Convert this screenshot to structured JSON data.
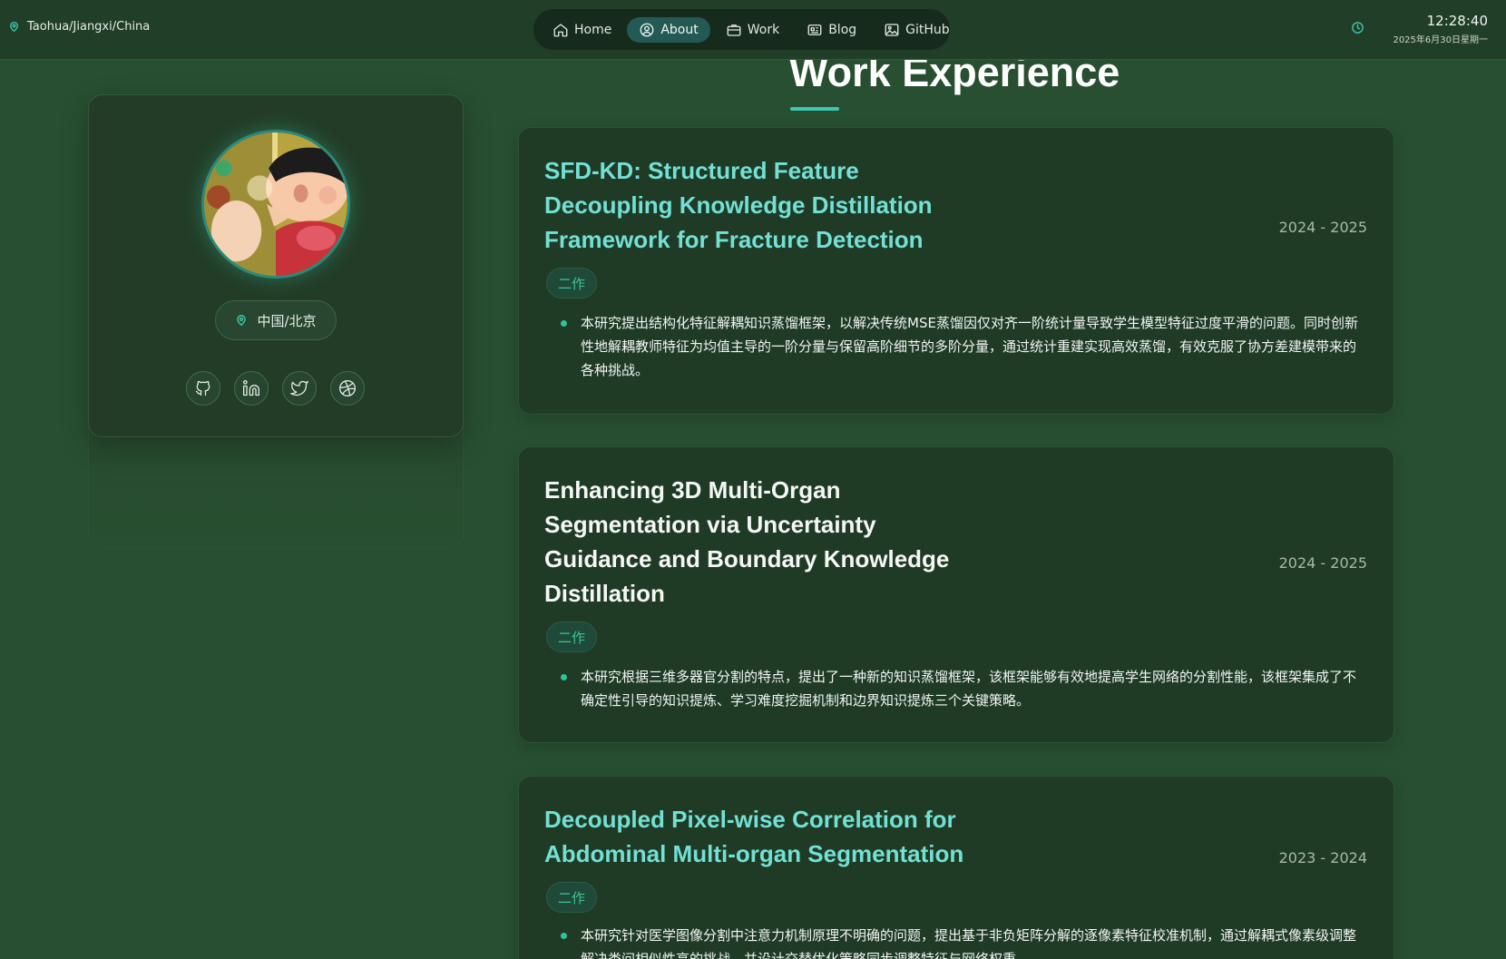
{
  "topbar": {
    "location": "Taohua/Jiangxi/China",
    "time": "12:28:40",
    "date": "2025年6月30日星期一"
  },
  "nav": [
    {
      "label": "Home",
      "icon": "home-icon",
      "active": false
    },
    {
      "label": "About",
      "icon": "user-circle-icon",
      "active": true
    },
    {
      "label": "Work",
      "icon": "briefcase-icon",
      "active": false
    },
    {
      "label": "Blog",
      "icon": "newspaper-icon",
      "active": false
    },
    {
      "label": "GitHub",
      "icon": "image-icon",
      "active": false
    }
  ],
  "profile": {
    "location": "中国/北京",
    "socials": [
      "github-icon",
      "linkedin-icon",
      "twitter-icon",
      "dribbble-icon"
    ]
  },
  "section": {
    "title": "Work Experience"
  },
  "works": [
    {
      "title": "SFD-KD: Structured Feature Decoupling Knowledge Distillation Framework for Fracture Detection",
      "date": "2024 - 2025",
      "badge": "二作",
      "description": "本研究提出结构化特征解耦知识蒸馏框架，以解决传统MSE蒸馏因仅对齐一阶统计量导致学生模型特征过度平滑的问题。同时创新性地解耦教师特征为均值主导的一阶分量与保留高阶细节的多阶分量，通过统计重建实现高效蒸馏，有效克服了协方差建模带来的各种挑战。"
    },
    {
      "title": "Enhancing 3D Multi-Organ Segmentation via Uncertainty Guidance and Boundary Knowledge Distillation",
      "date": "2024 - 2025",
      "badge": "二作",
      "description": "本研究根据三维多器官分割的特点，提出了一种新的知识蒸馏框架，该框架能够有效地提高学生网络的分割性能，该框架集成了不确定性引导的知识提炼、学习难度挖掘机制和边界知识提炼三个关键策略。"
    },
    {
      "title": "Decoupled Pixel-wise Correlation for Abdominal Multi-organ Segmentation",
      "date": "2023 - 2024",
      "badge": "二作",
      "description": "本研究针对医学图像分割中注意力机制原理不明确的问题，提出基于非负矩阵分解的逐像素特征校准机制，通过解耦式像素级调整解决类间相似性高的挑战，并设计交替优化策略同步调整特征与网络权重。"
    }
  ],
  "colors": {
    "background": "#284f31",
    "card": "#1f3b26",
    "accent": "#3cc8b2",
    "title_cyan": "#73e0d4",
    "badge_green": "#3ec29a"
  }
}
